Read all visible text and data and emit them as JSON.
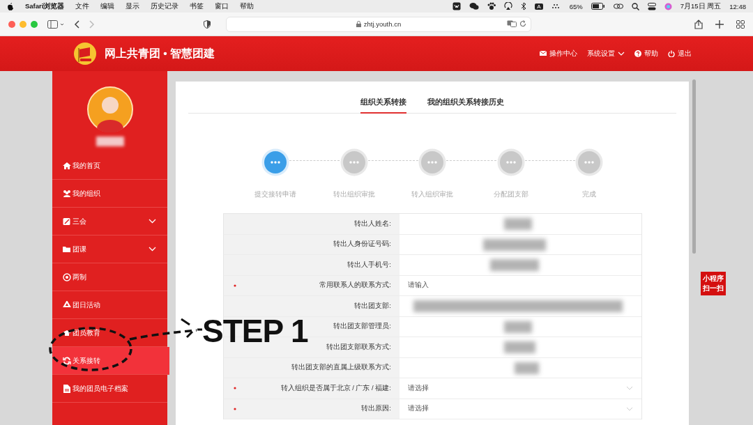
{
  "menubar": {
    "app": "Safari浏览器",
    "menus": [
      "文件",
      "编辑",
      "显示",
      "历史记录",
      "书签",
      "窗口",
      "帮助"
    ],
    "input_method": "A",
    "battery_text": "65%",
    "date": "7月15日 周五",
    "time": "12:48"
  },
  "browser": {
    "url": "zhtj.youth.cn"
  },
  "header": {
    "title": "网上共青团 • 智慧团建",
    "actions": [
      {
        "kind": "mail",
        "label": "操作中心"
      },
      {
        "kind": "dropdown",
        "label": "系统设置"
      },
      {
        "kind": "help",
        "label": "帮助"
      },
      {
        "kind": "power",
        "label": "退出"
      }
    ]
  },
  "sidebar": {
    "items": [
      {
        "label": "我的首页",
        "kind": "link",
        "selected": false
      },
      {
        "label": "我的组织",
        "kind": "link",
        "selected": false
      },
      {
        "label": "三会",
        "kind": "group",
        "selected": false
      },
      {
        "label": "团课",
        "kind": "group",
        "selected": false
      },
      {
        "label": "两制",
        "kind": "link",
        "selected": false
      },
      {
        "label": "团日活动",
        "kind": "link",
        "selected": false
      },
      {
        "label": "团员教育",
        "kind": "link",
        "selected": false
      },
      {
        "label": "关系接转",
        "kind": "link",
        "selected": true
      },
      {
        "label": "我的团员电子档案",
        "kind": "link",
        "selected": false
      }
    ]
  },
  "tabs": [
    {
      "label": "组织关系转接",
      "selected": true
    },
    {
      "label": "我的组织关系转接历史",
      "selected": false
    }
  ],
  "steps": [
    {
      "label": "提交接转申请",
      "selected": true
    },
    {
      "label": "转出组织审批",
      "selected": false
    },
    {
      "label": "转入组织审批",
      "selected": false
    },
    {
      "label": "分配团支部",
      "selected": false
    },
    {
      "label": "完成",
      "selected": false
    }
  ],
  "form": [
    {
      "label": "转出人姓名:",
      "required": false,
      "kind": "redacted"
    },
    {
      "label": "转出人身份证号码:",
      "required": false,
      "kind": "redacted"
    },
    {
      "label": "转出人手机号:",
      "required": false,
      "kind": "redacted"
    },
    {
      "label": "常用联系人的联系方式:",
      "required": true,
      "kind": "input",
      "placeholder": "请输入"
    },
    {
      "label": "转出团支部:",
      "required": false,
      "kind": "redacted"
    },
    {
      "label": "转出团支部管理员:",
      "required": false,
      "kind": "redacted"
    },
    {
      "label": "转出团支部联系方式:",
      "required": false,
      "kind": "redacted"
    },
    {
      "label": "转出团支部的直属上级联系方式:",
      "required": false,
      "kind": "redacted"
    },
    {
      "label": "转入组织是否属于北京 / 广东 / 福建:",
      "required": true,
      "kind": "select",
      "placeholder": "请选择"
    },
    {
      "label": "转出原因:",
      "required": true,
      "kind": "select",
      "placeholder": "请选择"
    }
  ],
  "float_badge": {
    "lines": [
      "小程序",
      "扫一扫"
    ]
  },
  "annotation": {
    "text": "STEP 1"
  }
}
